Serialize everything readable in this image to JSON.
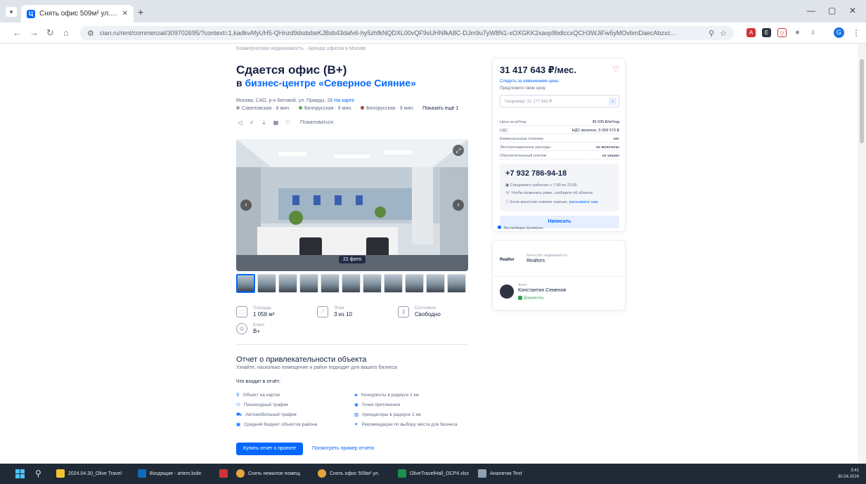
{
  "browser": {
    "tab_title": "Снять офис 509м² ул. Правд...",
    "tab_favicon": "Ц",
    "url": "cian.ru/rent/commercial/309702695/?context=1,kadkvAfyUH5-QHnzd9dsdxbeKJBsb43dafv6-hy5zhfkNQDXL00vQF9sUHNfkA8C-DJm9u7yW8N1-xOXGKK2xavp9bdlccxQCH3WJiFw5yMOvbmDaecAbzxc...",
    "zoom_icon": "search-icon",
    "bookmark_icon": "star-icon"
  },
  "page": {
    "breadcrumbs": "Коммерческая недвижимость · Аренда офисов в Москве",
    "title_line1": "Сдается офис (B+)",
    "title_prefix": "в",
    "title_link": "бизнес-центре «Северное Сияние»",
    "address": "Москва, САО, р-н Беговой, ул. Правды, 26",
    "address_link": "На карте",
    "metro": [
      {
        "name": "Савеловская · 8 мин.",
        "color": "#a0a2a3"
      },
      {
        "name": "Белорусская · 9 мин.",
        "color": "#4fb04f"
      },
      {
        "name": "Белорусская · 9 мин.",
        "color": "#915133"
      }
    ],
    "metro_more": "Показать ещё 1",
    "complain": "Пожаловаться",
    "photo_count": "21 фото",
    "params": [
      {
        "label": "Площадь",
        "value": "1 058 м²"
      },
      {
        "label": "Этаж",
        "value": "3 из 10"
      },
      {
        "label": "Состояние",
        "value": "Свободно"
      },
      {
        "label": "Класс",
        "value": "B+"
      }
    ],
    "report": {
      "title": "Отчет о привлекательности объекта",
      "subtitle": "Узнайте, насколько помещение и район подходят для вашего бизнеса",
      "includes": "Что входит в отчёт:",
      "items": [
        "Объект на картах",
        "Пешеходный трафик",
        "Автомобильный трафик",
        "Средний бюджет объектов района",
        "Конкуренты в радиусе 1 км",
        "Точки притяжения",
        "Арендаторы в радиусе 1 км",
        "Рекомендации по выбору места для бизнеса"
      ],
      "buy_button": "Купить отчет о проекте",
      "example_link": "Посмотреть пример отчета"
    }
  },
  "card": {
    "price": "31 417 643 ₽/мес.",
    "price_link": "Следить за изменением цены",
    "offer_label": "Предложите свою цену",
    "offer_placeholder": "Например, 31 177 643 ₽",
    "specs": [
      {
        "k": "Цена за м²/год",
        "v": "35 635 ₽/м²/год"
      },
      {
        "k": "НДС",
        "v": "НДС включен, 5 069 573 ₽"
      },
      {
        "k": "Коммунальные платежи",
        "v": "нет"
      },
      {
        "k": "Эксплуатационные расходы",
        "v": "не включены"
      },
      {
        "k": "Обеспечительный платёж",
        "v": "не указан"
      }
    ],
    "phone": "+7 932 786-94-18",
    "phone_notes": [
      "Специалист работает с 7:00 по 22:00",
      "Чтобы позвонить реже, сообщите об объекте",
      "Если агентство ответит хорошо,"
    ],
    "phone_note_link": "расскажите нам",
    "write_button": "Написать",
    "under_card": "Застройщик проверен",
    "agency_label": "Агентство недвижимости",
    "agency_logo": "Realtor",
    "agency_name": "Realtors",
    "agent_label": "Агент",
    "agent_name": "Константин Семенов",
    "agent_badge": "Документы"
  },
  "taskbar": {
    "items": [
      {
        "label": "2024.04.30_Olive Travel",
        "color": "#f4c430"
      },
      {
        "label": "Входящие - artem.kolin",
        "color": "#0f6cbd"
      },
      {
        "label": "",
        "color": "#d13438"
      },
      {
        "label": "Снять нежилое помещ",
        "color": "#e8a33c"
      },
      {
        "label": "Снять офис 509м² ул.",
        "color": "#e8a33c"
      },
      {
        "label": "OliveTravelHall_OCP4.xlsx",
        "color": "#1d8f4e"
      },
      {
        "label": "Аналитик Text",
        "color": "#8ca0b6"
      }
    ],
    "time": "3:41",
    "date": "30.04.2024"
  }
}
